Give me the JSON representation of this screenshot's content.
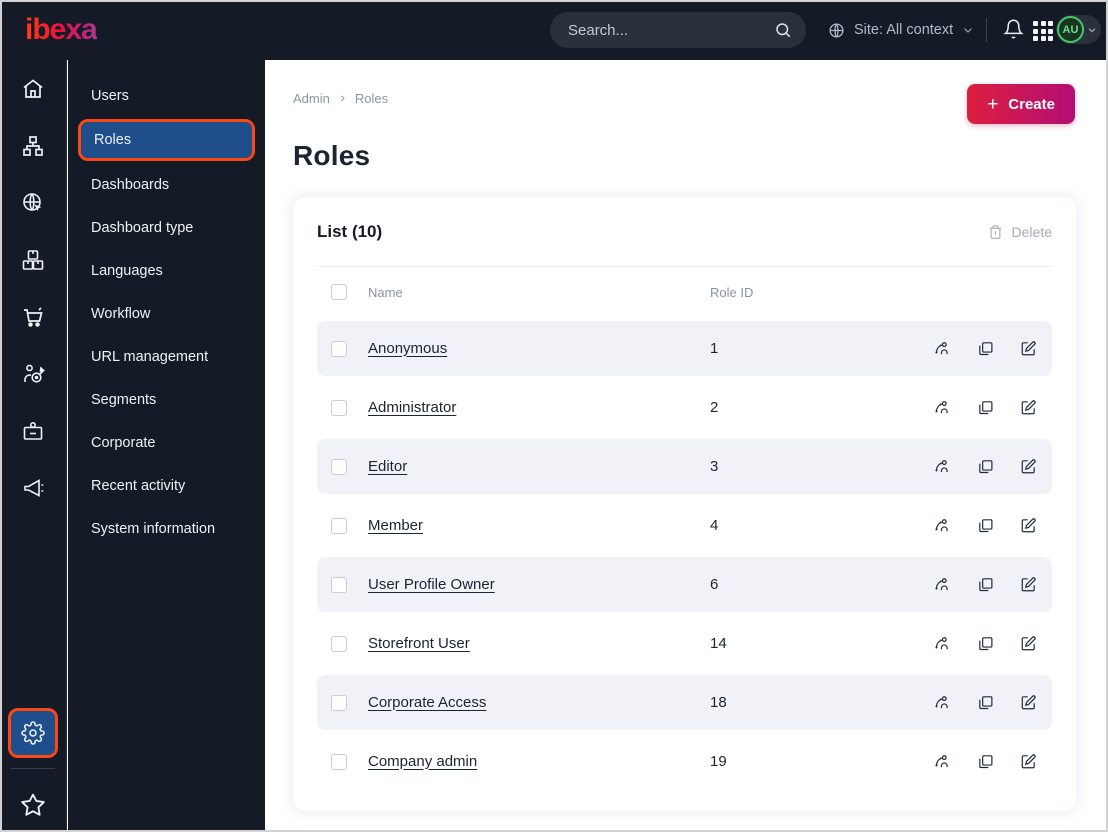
{
  "topbar": {
    "logo_text": "ibexa",
    "search_placeholder": "Search...",
    "site_context_label": "Site: All context",
    "avatar_initials": "AU"
  },
  "icons": {
    "topbar": [
      "search-icon",
      "globe-icon",
      "chevron-down-icon",
      "bell-icon",
      "app-grid-icon",
      "avatar",
      "chevron-down-icon"
    ],
    "rail": [
      "home-icon",
      "content-tree-icon",
      "site-globe-icon",
      "product-boxes-icon",
      "commerce-cart-icon",
      "personalization-target-icon",
      "corporate-badge-icon",
      "marketing-megaphone-icon",
      "admin-gear-icon",
      "bookmarks-star-icon"
    ],
    "row_actions": [
      "assign-users-icon",
      "copy-icon",
      "edit-icon"
    ],
    "list_header": [
      "trash-icon"
    ]
  },
  "sidebar": {
    "items": [
      {
        "label": "Users",
        "selected": false
      },
      {
        "label": "Roles",
        "selected": true
      },
      {
        "label": "Dashboards",
        "selected": false
      },
      {
        "label": "Dashboard type",
        "selected": false
      },
      {
        "label": "Languages",
        "selected": false
      },
      {
        "label": "Workflow",
        "selected": false
      },
      {
        "label": "URL management",
        "selected": false
      },
      {
        "label": "Segments",
        "selected": false
      },
      {
        "label": "Corporate",
        "selected": false
      },
      {
        "label": "Recent activity",
        "selected": false
      },
      {
        "label": "System information",
        "selected": false
      }
    ]
  },
  "main": {
    "breadcrumb": {
      "crumb1": "Admin",
      "crumb2": "Roles"
    },
    "create_label": "Create",
    "page_title": "Roles",
    "list": {
      "title": "List (10)",
      "delete_label": "Delete",
      "columns": {
        "name": "Name",
        "role_id": "Role ID"
      },
      "rows": [
        {
          "name": "Anonymous",
          "role_id": "1"
        },
        {
          "name": "Administrator",
          "role_id": "2"
        },
        {
          "name": "Editor",
          "role_id": "3"
        },
        {
          "name": "Member",
          "role_id": "4"
        },
        {
          "name": "User Profile Owner",
          "role_id": "6"
        },
        {
          "name": "Storefront User",
          "role_id": "14"
        },
        {
          "name": "Corporate Access",
          "role_id": "18"
        },
        {
          "name": "Company admin",
          "role_id": "19"
        }
      ]
    }
  },
  "colors": {
    "topbar_bg": "#141b27",
    "annotation_orange": "#fa4713",
    "selected_blue": "#1d4e8a",
    "create_gradient_start": "#dc1f3e",
    "create_gradient_end": "#b30e76",
    "avatar_green": "#46c869",
    "row_stripe": "#f0f2f7",
    "text_dark": "#1a2433",
    "text_muted": "#8b93a4"
  }
}
